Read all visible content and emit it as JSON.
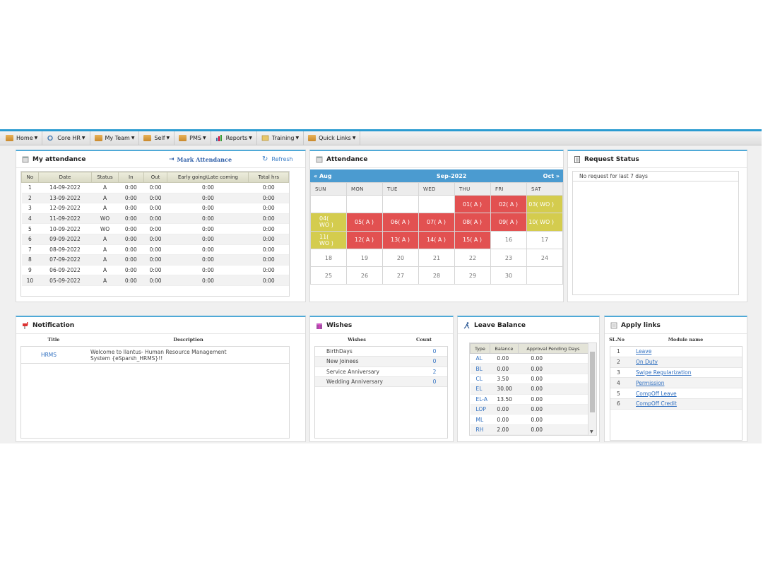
{
  "nav": [
    {
      "label": "Home",
      "icon": "folder-icon"
    },
    {
      "label": "Core HR",
      "icon": "gear-icon"
    },
    {
      "label": "My Team",
      "icon": "folder-icon"
    },
    {
      "label": "Self",
      "icon": "folder-icon"
    },
    {
      "label": "PMS",
      "icon": "folder-icon"
    },
    {
      "label": "Reports",
      "icon": "bar-chart-icon"
    },
    {
      "label": "Training",
      "icon": "training-icon"
    },
    {
      "label": "Quick Links",
      "icon": "folder-icon"
    }
  ],
  "my_attendance": {
    "title": "My attendance",
    "mark_label": "Mark Attendance",
    "refresh_label": "Refresh",
    "columns": [
      "No",
      "Date",
      "Status",
      "In",
      "Out",
      "Early going\\Late coming",
      "Total hrs"
    ],
    "rows": [
      [
        "1",
        "14-09-2022",
        "A",
        "0:00",
        "0:00",
        "0:00",
        "0:00"
      ],
      [
        "2",
        "13-09-2022",
        "A",
        "0:00",
        "0:00",
        "0:00",
        "0:00"
      ],
      [
        "3",
        "12-09-2022",
        "A",
        "0:00",
        "0:00",
        "0:00",
        "0:00"
      ],
      [
        "4",
        "11-09-2022",
        "WO",
        "0:00",
        "0:00",
        "0:00",
        "0:00"
      ],
      [
        "5",
        "10-09-2022",
        "WO",
        "0:00",
        "0:00",
        "0:00",
        "0:00"
      ],
      [
        "6",
        "09-09-2022",
        "A",
        "0:00",
        "0:00",
        "0:00",
        "0:00"
      ],
      [
        "7",
        "08-09-2022",
        "A",
        "0:00",
        "0:00",
        "0:00",
        "0:00"
      ],
      [
        "8",
        "07-09-2022",
        "A",
        "0:00",
        "0:00",
        "0:00",
        "0:00"
      ],
      [
        "9",
        "06-09-2022",
        "A",
        "0:00",
        "0:00",
        "0:00",
        "0:00"
      ],
      [
        "10",
        "05-09-2022",
        "A",
        "0:00",
        "0:00",
        "0:00",
        "0:00"
      ]
    ]
  },
  "calendar": {
    "title": "Attendance",
    "prev": "Aug",
    "month": "Sep-2022",
    "next": "Oct",
    "days": [
      "SUN",
      "MON",
      "TUE",
      "WED",
      "THU",
      "FRI",
      "SAT"
    ],
    "weeks": [
      [
        {
          "t": "",
          "s": ""
        },
        {
          "t": "",
          "s": ""
        },
        {
          "t": "",
          "s": ""
        },
        {
          "t": "",
          "s": ""
        },
        {
          "t": "01( A )",
          "s": "ab"
        },
        {
          "t": "02( A )",
          "s": "ab"
        },
        {
          "t": "03( WO )",
          "s": "wo"
        }
      ],
      [
        {
          "t": "04( WO )",
          "s": "wo"
        },
        {
          "t": "05( A )",
          "s": "ab"
        },
        {
          "t": "06( A )",
          "s": "ab"
        },
        {
          "t": "07( A )",
          "s": "ab"
        },
        {
          "t": "08( A )",
          "s": "ab"
        },
        {
          "t": "09( A )",
          "s": "ab"
        },
        {
          "t": "10( WO )",
          "s": "wo"
        }
      ],
      [
        {
          "t": "11( WO )",
          "s": "wo"
        },
        {
          "t": "12( A )",
          "s": "ab"
        },
        {
          "t": "13( A )",
          "s": "ab"
        },
        {
          "t": "14( A )",
          "s": "ab"
        },
        {
          "t": "15( A )",
          "s": "ab"
        },
        {
          "t": "16",
          "s": ""
        },
        {
          "t": "17",
          "s": ""
        }
      ],
      [
        {
          "t": "18",
          "s": ""
        },
        {
          "t": "19",
          "s": ""
        },
        {
          "t": "20",
          "s": ""
        },
        {
          "t": "21",
          "s": ""
        },
        {
          "t": "22",
          "s": ""
        },
        {
          "t": "23",
          "s": ""
        },
        {
          "t": "24",
          "s": ""
        }
      ],
      [
        {
          "t": "25",
          "s": ""
        },
        {
          "t": "26",
          "s": ""
        },
        {
          "t": "27",
          "s": ""
        },
        {
          "t": "28",
          "s": ""
        },
        {
          "t": "29",
          "s": ""
        },
        {
          "t": "30",
          "s": ""
        },
        {
          "t": "",
          "s": ""
        }
      ]
    ],
    "colors": {
      "absent": "#e25151",
      "weekoff": "#d4cc4e",
      "header": "#4b9bd0"
    }
  },
  "request_status": {
    "title": "Request Status",
    "message": "No request for last 7 days"
  },
  "notification": {
    "title": "Notification",
    "col_title": "Title",
    "col_desc": "Description",
    "item_title": "HRMS",
    "item_desc": "Welcome to Ilantus- Human Resource Management System {eSparsh_HRMS}!!"
  },
  "wishes": {
    "title": "Wishes",
    "col_wishes": "Wishes",
    "col_count": "Count",
    "rows": [
      [
        "BirthDays",
        "0"
      ],
      [
        "New Joinees",
        "0"
      ],
      [
        "Service Anniversary",
        "2"
      ],
      [
        "Wedding Anniversary",
        "0"
      ]
    ]
  },
  "leave_balance": {
    "title": "Leave Balance",
    "columns": [
      "Type",
      "Balance",
      "Approval Pending Days"
    ],
    "rows": [
      [
        "AL",
        "0.00",
        "0.00"
      ],
      [
        "BL",
        "0.00",
        "0.00"
      ],
      [
        "CL",
        "3.50",
        "0.00"
      ],
      [
        "EL",
        "30.00",
        "0.00"
      ],
      [
        "EL-A",
        "13.50",
        "0.00"
      ],
      [
        "LOP",
        "0.00",
        "0.00"
      ],
      [
        "ML",
        "0.00",
        "0.00"
      ],
      [
        "RH",
        "2.00",
        "0.00"
      ]
    ]
  },
  "apply_links": {
    "title": "Apply links",
    "col_no": "SL.No",
    "col_name": "Module name",
    "rows": [
      [
        "1",
        "Leave"
      ],
      [
        "2",
        "On Duty"
      ],
      [
        "3",
        "Swipe Regularization"
      ],
      [
        "4",
        "Permission"
      ],
      [
        "5",
        "CompOff Leave"
      ],
      [
        "6",
        "CompOff Credit"
      ]
    ]
  }
}
